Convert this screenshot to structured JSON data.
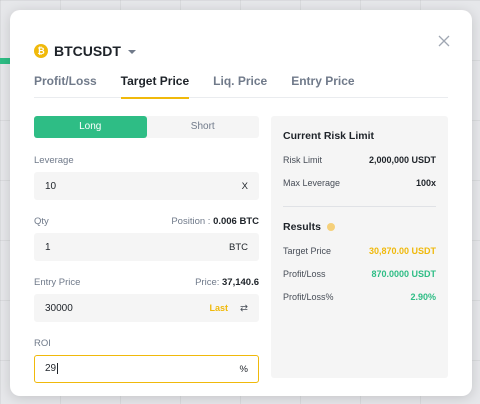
{
  "symbol": {
    "name": "BTCUSDT",
    "coin_glyph": "₿"
  },
  "tabs": [
    {
      "label": "Profit/Loss",
      "active": false
    },
    {
      "label": "Target Price",
      "active": true
    },
    {
      "label": "Liq. Price",
      "active": false
    },
    {
      "label": "Entry Price",
      "active": false
    }
  ],
  "side": {
    "long_label": "Long",
    "short_label": "Short",
    "selected": "Long"
  },
  "leverage": {
    "label": "Leverage",
    "value": "10",
    "unit": "X"
  },
  "qty": {
    "label": "Qty",
    "hint_label": "Position :",
    "hint_value": "0.006 BTC",
    "value": "1",
    "unit": "BTC"
  },
  "entry_price": {
    "label": "Entry Price",
    "hint_label": "Price:",
    "hint_value": "37,140.6",
    "value": "30000",
    "last_label": "Last",
    "swap_glyph": "⇄"
  },
  "roi": {
    "label": "ROI",
    "value": "29",
    "unit": "%"
  },
  "risk": {
    "title": "Current Risk Limit",
    "risk_limit_label": "Risk Limit",
    "risk_limit_value": "2,000,000 USDT",
    "max_leverage_label": "Max Leverage",
    "max_leverage_value": "100x"
  },
  "results": {
    "title": "Results",
    "target_price_label": "Target Price",
    "target_price_value": "30,870.00 USDT",
    "pnl_label": "Profit/Loss",
    "pnl_value": "870.0000 USDT",
    "pnl_pct_label": "Profit/Loss%",
    "pnl_pct_value": "2.90%"
  },
  "colors": {
    "accent": "#f0b90b",
    "long": "#2ebd85",
    "text": "#1e2329",
    "muted": "#707a8a"
  }
}
